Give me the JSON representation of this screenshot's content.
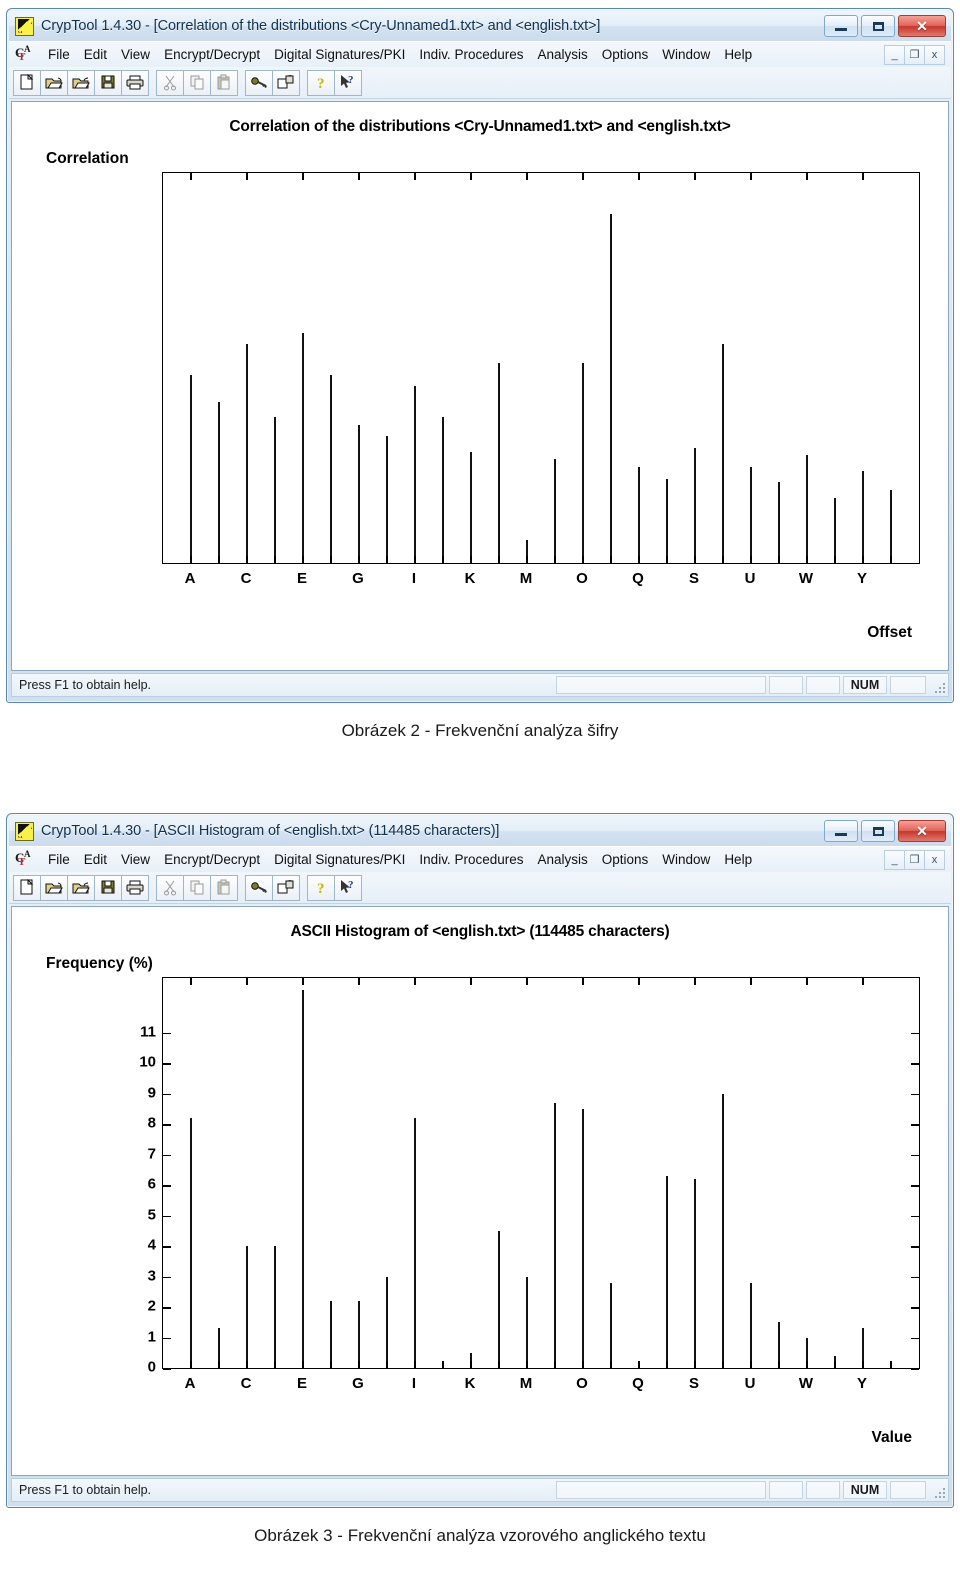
{
  "windows": [
    {
      "title": "CrypTool 1.4.30 - [Correlation of the distributions <Cry-Unnamed1.txt> and <english.txt>]",
      "menu": [
        "File",
        "Edit",
        "View",
        "Encrypt/Decrypt",
        "Digital Signatures/PKI",
        "Indiv. Procedures",
        "Analysis",
        "Options",
        "Window",
        "Help"
      ],
      "toolbar": [
        "new-document-icon",
        "open-folder-icon",
        "open-folder-alt-icon",
        "save-disk-icon",
        "print-icon",
        "cut-scissors-icon",
        "copy-icon",
        "paste-icon",
        "key-icon",
        "encrypt-window-icon",
        "help-question-icon",
        "help-pointer-icon"
      ],
      "window_buttons": {
        "minimize": "minimize-icon",
        "maximize": "maximize-icon",
        "close": "close-icon"
      },
      "mdi_buttons": {
        "minimize": "_",
        "restore": "restore-icon",
        "close": "x"
      },
      "status": {
        "hint": "Press F1 to obtain help.",
        "num": "NUM"
      },
      "caption": "Obrázek 2 - Frekvenční analýza šifry"
    },
    {
      "title": "CrypTool 1.4.30 - [ASCII Histogram of <english.txt> (114485 characters)]",
      "menu": [
        "File",
        "Edit",
        "View",
        "Encrypt/Decrypt",
        "Digital Signatures/PKI",
        "Indiv. Procedures",
        "Analysis",
        "Options",
        "Window",
        "Help"
      ],
      "toolbar": [
        "new-document-icon",
        "open-folder-icon",
        "open-folder-alt-icon",
        "save-disk-icon",
        "print-icon",
        "cut-scissors-icon",
        "copy-icon",
        "paste-icon",
        "key-icon",
        "encrypt-window-icon",
        "help-question-icon",
        "help-pointer-icon"
      ],
      "window_buttons": {
        "minimize": "minimize-icon",
        "maximize": "maximize-icon",
        "close": "close-icon"
      },
      "mdi_buttons": {
        "minimize": "_",
        "restore": "restore-icon",
        "close": "x"
      },
      "status": {
        "hint": "Press F1 to obtain help.",
        "num": "NUM"
      },
      "caption": "Obrázek 3 - Frekvenční analýza vzorového anglického textu"
    }
  ],
  "chart_data": [
    {
      "type": "bar",
      "title": "Correlation of the distributions <Cry-Unnamed1.txt> and <english.txt>",
      "ylabel": "Correlation",
      "xlabel": "Offset",
      "grid": false,
      "legend": "none",
      "tick_labels_x": [
        "A",
        "C",
        "E",
        "G",
        "I",
        "K",
        "M",
        "O",
        "Q",
        "S",
        "U",
        "W",
        "Y"
      ],
      "tick_labels_y": [],
      "ylim": [
        0,
        100
      ],
      "categories": [
        "A",
        "B",
        "C",
        "D",
        "E",
        "F",
        "G",
        "H",
        "I",
        "J",
        "K",
        "L",
        "M",
        "N",
        "O",
        "P",
        "Q",
        "R",
        "S",
        "T",
        "U",
        "V",
        "W",
        "X",
        "Y",
        "Z"
      ],
      "values": [
        49,
        42,
        57,
        38,
        60,
        49,
        36,
        33,
        46,
        38,
        29,
        52,
        6,
        27,
        52,
        91,
        25,
        22,
        30,
        57,
        25,
        21,
        28,
        17,
        24,
        19
      ]
    },
    {
      "type": "bar",
      "title": "ASCII Histogram of <english.txt> (114485 characters)",
      "ylabel": "Frequency (%)",
      "xlabel": "Value",
      "grid": false,
      "legend": "none",
      "tick_labels_x": [
        "A",
        "C",
        "E",
        "G",
        "I",
        "K",
        "M",
        "O",
        "Q",
        "S",
        "U",
        "W",
        "Y"
      ],
      "tick_labels_y": [
        "0",
        "1",
        "2",
        "3",
        "4",
        "5",
        "6",
        "7",
        "8",
        "9",
        "10",
        "11"
      ],
      "ylim": [
        0,
        12.6
      ],
      "categories": [
        "A",
        "B",
        "C",
        "D",
        "E",
        "F",
        "G",
        "H",
        "I",
        "J",
        "K",
        "L",
        "M",
        "N",
        "O",
        "P",
        "Q",
        "R",
        "S",
        "T",
        "U",
        "V",
        "W",
        "X",
        "Y",
        "Z"
      ],
      "values": [
        8.2,
        1.3,
        4.0,
        4.0,
        12.4,
        2.2,
        2.2,
        3.0,
        8.2,
        0.2,
        0.5,
        4.5,
        3.0,
        8.7,
        8.5,
        2.8,
        0.2,
        6.3,
        6.2,
        9.0,
        2.8,
        1.5,
        1.0,
        0.4,
        1.3,
        0.2
      ]
    }
  ]
}
